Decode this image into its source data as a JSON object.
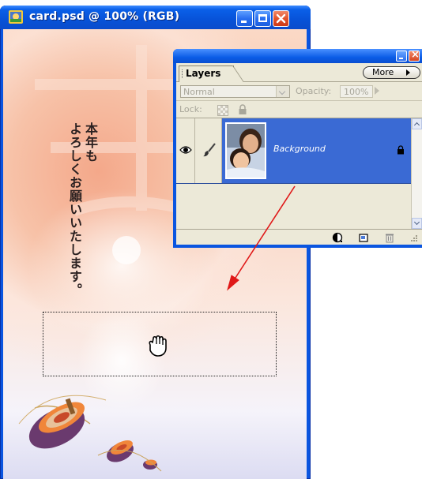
{
  "document_window": {
    "title": "card.psd @ 100% (RGB)",
    "canvas_text": {
      "column_1": "本年も",
      "column_2": "よろしくお願いいたします。"
    }
  },
  "layers_palette": {
    "tab_label": "Layers",
    "more_label": "More",
    "blend_mode": "Normal",
    "opacity_label": "Opacity:",
    "opacity_value": "100%",
    "lock_label": "Lock:",
    "layers": [
      {
        "name": "Background",
        "visible": true,
        "locked": true,
        "selected": true
      }
    ]
  },
  "colors": {
    "xp_title_blue": "#0a55e0",
    "selected_layer": "#3a6ad4",
    "arrow": "#e01818",
    "palette_bg": "#ece9d8"
  },
  "icons": {
    "doc": "photoshop-document-icon",
    "cursor": "hand-grab-icon",
    "eye": "eye-icon",
    "brush": "brush-icon"
  }
}
